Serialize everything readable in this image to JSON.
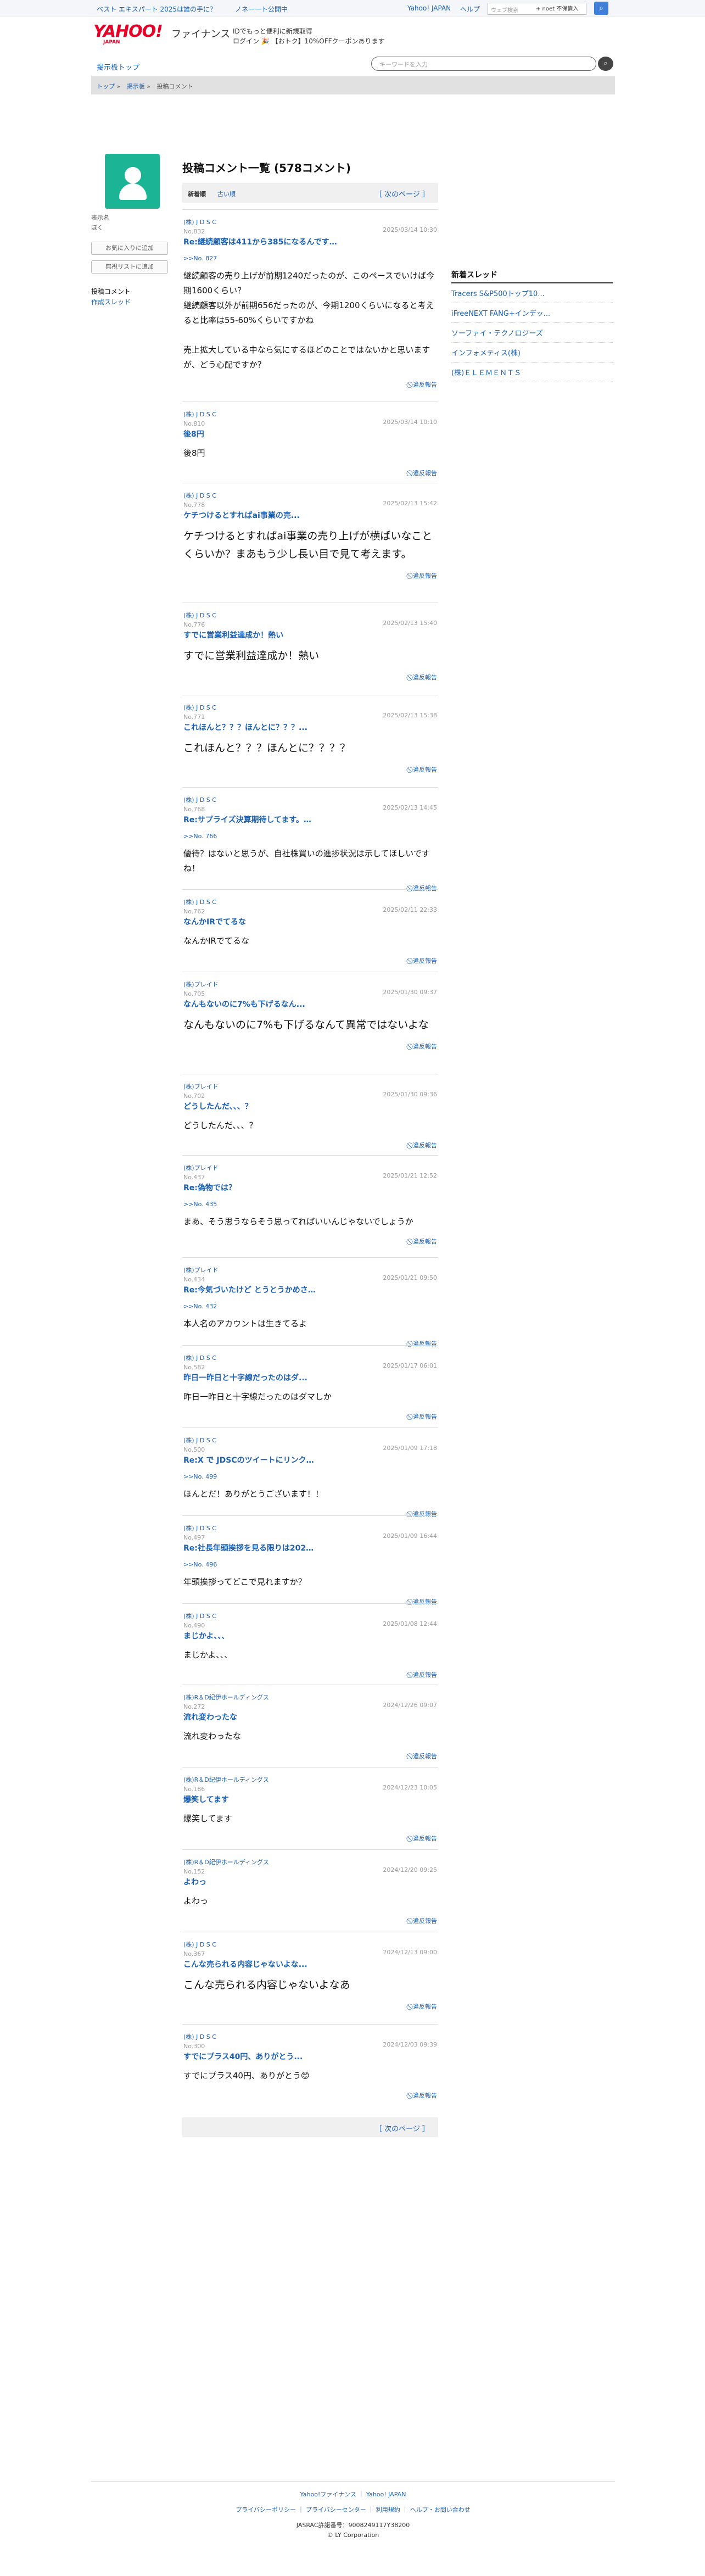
{
  "topbar": {
    "link1": "ベスト エキスパート 2025は誰の手に？",
    "link2": "ノネーート公開中",
    "yahoo": "Yahoo! JAPAN",
    "help": "ヘルプ",
    "search_placeholder": "ウェブ検索",
    "search_select": "+ noet 不保債入"
  },
  "logo": {
    "main": "YAHOO!",
    "sub": "JAPAN",
    "fin": "ファイナンス"
  },
  "promo": {
    "line1": "IDでもっと便利に新規取得",
    "line2": "ログイン 🎉 【おトク】10%OFFクーポンあります"
  },
  "nav": {
    "board_top": "掲示板トップ",
    "search_placeholder": "キーワードを入力"
  },
  "breadcrumb": [
    "トップ",
    "掲示板",
    "投稿コメント"
  ],
  "sidebar": {
    "user_label": "表示名",
    "user_name": "ぼく",
    "btn_fav": "お気に入りに追加",
    "btn_block": "無視リストに追加",
    "menu1": "投稿コメント",
    "menu2": "作成スレッド"
  },
  "main": {
    "title": "投稿コメント一覧 (578コメント)",
    "tab_new": "新着順",
    "tab_old": "古い順",
    "next": "［ 次のページ ］",
    "report": "違反報告"
  },
  "posts": [
    {
      "stock": "(株) J D S C",
      "no": "No.832",
      "date": "2025/03/14 10:30",
      "title": "Re:継続顧客は411から385になるんです&hellip;",
      "reply": ">>No. 827",
      "body": "継続顧客の売り上げが前期1240だったのが、このペースでいけば今期1600くらい？\n継続顧客以外が前期656だったのが、今期1200くらいになると考えると比率は55-60%くらいですかね\n\n売上拡大している中なら気にするほどのことではないかと思いますが、どう心配ですか？",
      "size": "f14"
    },
    {
      "stock": "(株) J D S C",
      "no": "No.810",
      "date": "2025/03/14 10:10",
      "title": "後8円",
      "reply": "",
      "body": "後8円",
      "size": "f14"
    },
    {
      "stock": "(株) J D S C",
      "no": "No.778",
      "date": "2025/02/13 15:42",
      "title": "ケチつけるとすればai事業の売...",
      "reply": "",
      "body": "ケチつけるとすればai事業の売り上げが横ばいなことくらいか？まあもう少し長い目で見て考えます。",
      "size": "f18"
    },
    {
      "stock": "(株) J D S C",
      "no": "No.776",
      "date": "2025/02/13 15:40",
      "title": "すでに営業利益達成か！熱い",
      "reply": "",
      "body": "すでに営業利益達成か！熱い",
      "size": "f18"
    },
    {
      "stock": "(株) J D S C",
      "no": "No.771",
      "date": "2025/02/13 15:38",
      "title": "これほんと？？？ほんとに？？？...",
      "reply": "",
      "body": "これほんと？？？ほんとに？？？？",
      "size": "f18"
    },
    {
      "stock": "(株) J D S C",
      "no": "No.768",
      "date": "2025/02/13 14:45",
      "title": "Re:サプライズ決算期待してます。&hellip;",
      "reply": ">>No. 766",
      "body": "優待？はないと思うが、自社株買いの進捗状況は示してほしいですね！",
      "size": "f14"
    },
    {
      "stock": "(株) J D S C",
      "no": "No.762",
      "date": "2025/02/11 22:33",
      "title": "なんかIRでてるな",
      "reply": "",
      "body": "なんかIRでてるな",
      "size": "f14"
    },
    {
      "stock": "(株)プレイド",
      "no": "No.705",
      "date": "2025/01/30 09:37",
      "title": "なんもないのに7%も下げるなん...",
      "reply": "",
      "body": "なんもないのに7%も下げるなんて異常ではないよな",
      "size": "f18"
    },
    {
      "stock": "(株)プレイド",
      "no": "No.702",
      "date": "2025/01/30 09:36",
      "title": "どうしたんだ、、、？",
      "reply": "",
      "body": "どうしたんだ、、、？",
      "size": "f14"
    },
    {
      "stock": "(株)プレイド",
      "no": "No.437",
      "date": "2025/01/21 12:52",
      "title": "Re:偽物では？",
      "reply": ">>No. 435",
      "body": "まあ、そう思うならそう思ってればいいんじゃないでしょうか",
      "size": "f14"
    },
    {
      "stock": "(株)プレイド",
      "no": "No.434",
      "date": "2025/01/21 09:50",
      "title": "Re:今気づいたけど とうとうかめさ&hellip;",
      "reply": ">>No. 432",
      "body": "本人名のアカウントは生きてるよ",
      "size": "f14"
    },
    {
      "stock": "(株) J D S C",
      "no": "No.582",
      "date": "2025/01/17 06:01",
      "title": "昨日一昨日と十字線だったのはダ...",
      "reply": "",
      "body": "昨日一昨日と十字線だったのはダマしか",
      "size": "f14"
    },
    {
      "stock": "(株) J D S C",
      "no": "No.500",
      "date": "2025/01/09 17:18",
      "title": "Re:X で JDSCのツイートにリンク&hellip;",
      "reply": ">>No. 499",
      "body": "ほんとだ！ありがとうございます！！",
      "size": "f14"
    },
    {
      "stock": "(株) J D S C",
      "no": "No.497",
      "date": "2025/01/09 16:44",
      "title": "Re:社長年頭挨拶を見る限りは202&hellip;",
      "reply": ">>No. 496",
      "body": "年頭挨拶ってどこで見れますか？",
      "size": "f14"
    },
    {
      "stock": "(株) J D S C",
      "no": "No.490",
      "date": "2025/01/08 12:44",
      "title": "まじかよ、、、",
      "reply": "",
      "body": "まじかよ、、、",
      "size": "f14"
    },
    {
      "stock": "(株)R＆D紀伊ホールディングス",
      "no": "No.272",
      "date": "2024/12/26 09:07",
      "title": "流れ変わったな",
      "reply": "",
      "body": "流れ変わったな",
      "size": "f14"
    },
    {
      "stock": "(株)R＆D紀伊ホールディングス",
      "no": "No.186",
      "date": "2024/12/23 10:05",
      "title": "爆笑してます",
      "reply": "",
      "body": "爆笑してます",
      "size": "f14"
    },
    {
      "stock": "(株)R＆D紀伊ホールディングス",
      "no": "No.152",
      "date": "2024/12/20 09:25",
      "title": "よわっ",
      "reply": "",
      "body": "よわっ",
      "size": "f14"
    },
    {
      "stock": "(株) J D S C",
      "no": "No.367",
      "date": "2024/12/13 09:00",
      "title": "こんな売られる内容じゃないよな...",
      "reply": "",
      "body": "こんな売られる内容じゃないよなあ",
      "size": "f18"
    },
    {
      "stock": "(株) J D S C",
      "no": "No.300",
      "date": "2024/12/03 09:39",
      "title": "すでにプラス40円、ありがとう...",
      "reply": "",
      "body": "すでにプラス40円、ありがとう😊",
      "size": "f14"
    }
  ],
  "right": {
    "head": "新着スレッド",
    "items": [
      "Tracers S&P500トップ10...",
      "iFreeNEXT FANG+インデッ...",
      "ソーファイ・テクノロジーズ",
      "インフォメティス(株)",
      "(株)ＥＬＥＭＥＮＴＳ"
    ]
  },
  "footer": {
    "l1": "Yahoo!ファイナンス ｜ Yahoo! JAPAN",
    "l2": "プライバシーポリシー ｜ プライバシーセンター ｜ 利用規約 ｜ ヘルプ・お問い合わせ",
    "reg": "JASRAC許諾番号：9008249117Y38200",
    "copy": "© LY Corporation"
  }
}
